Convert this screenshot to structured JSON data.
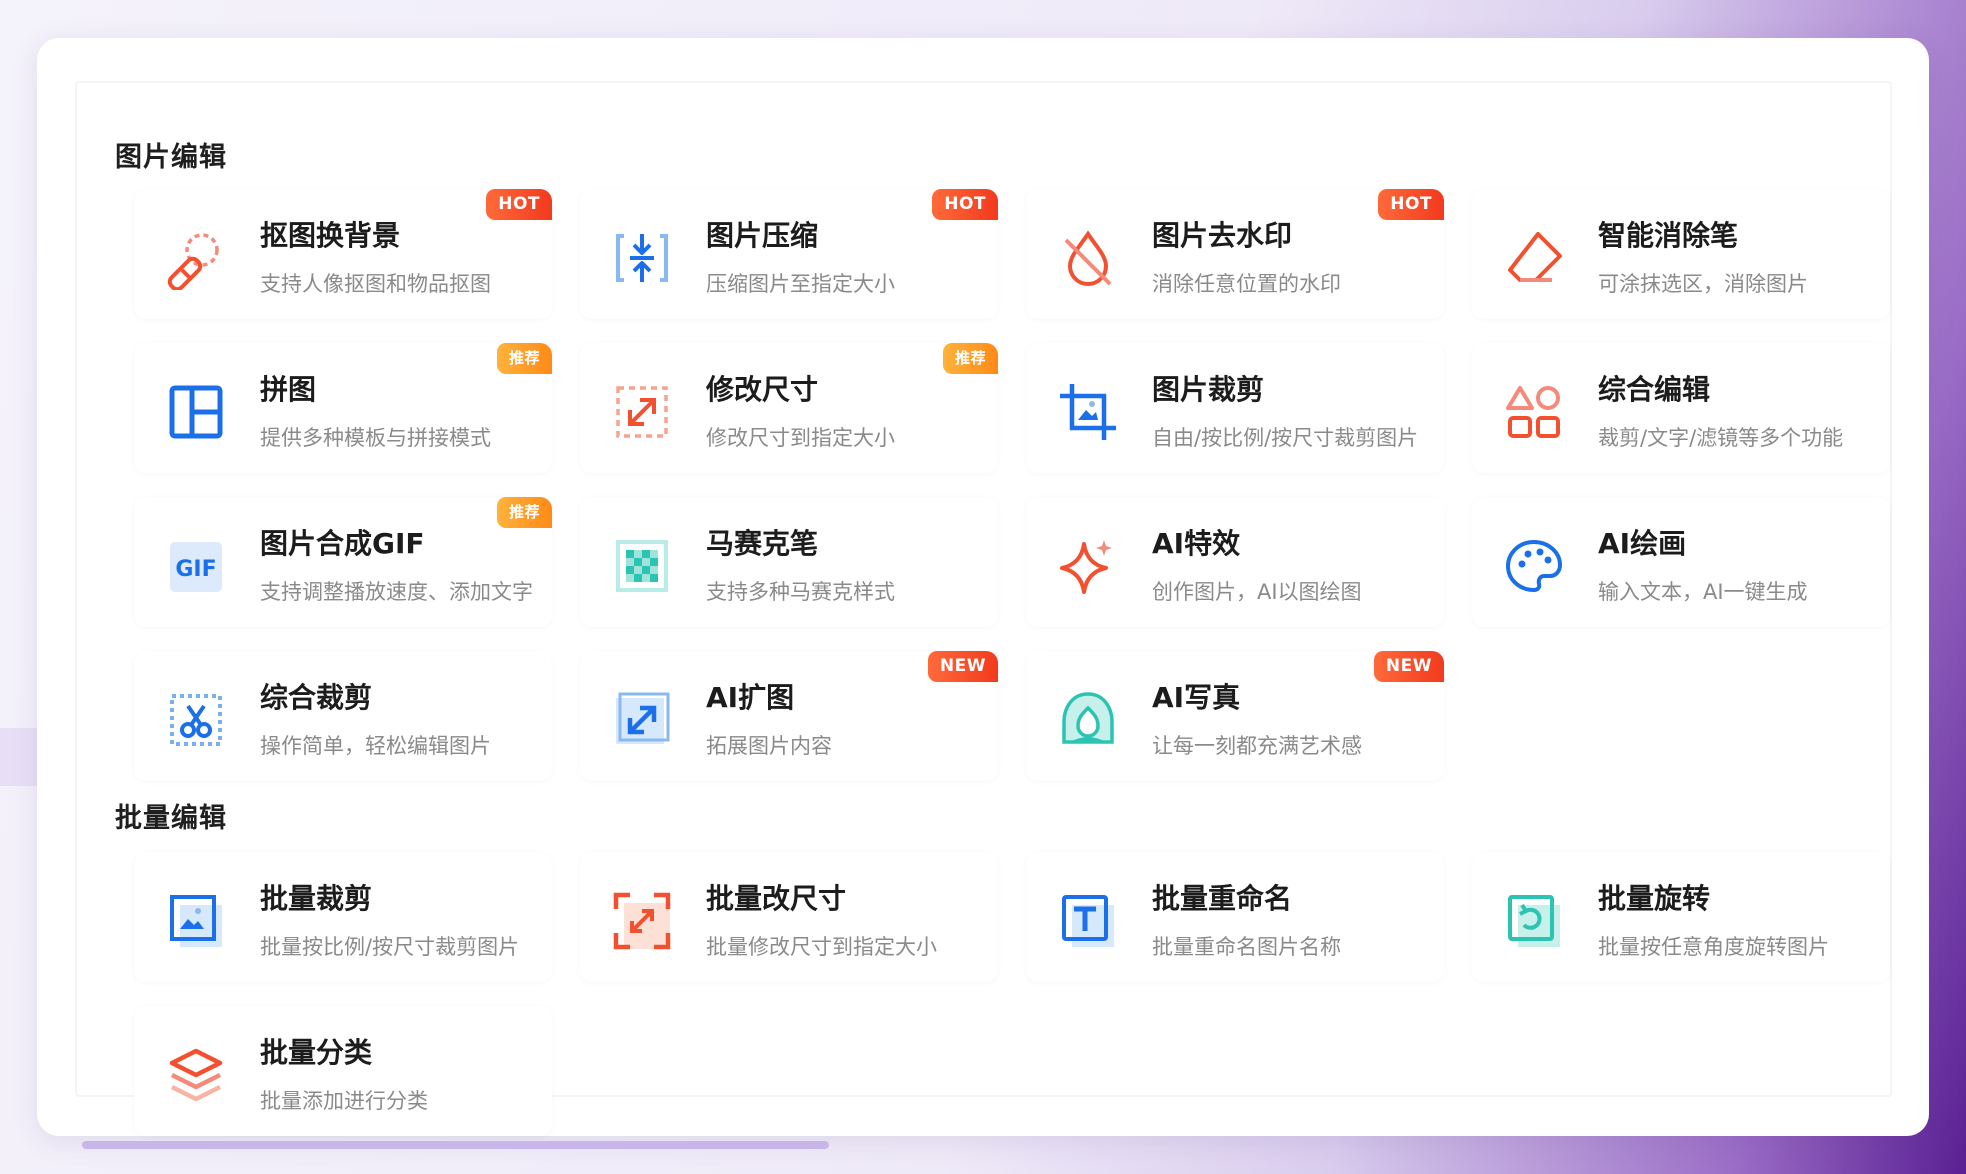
{
  "colors": {
    "hot": "#f4411f",
    "recommend": "#ff9a1f",
    "accent_blue": "#1b6fe8",
    "accent_orange": "#f2502e"
  },
  "sections": [
    {
      "title": "图片编辑",
      "items": [
        {
          "title": "抠图换背景",
          "desc": "支持人像抠图和物品抠图",
          "badge": "HOT",
          "icon": "cutout-icon"
        },
        {
          "title": "图片压缩",
          "desc": "压缩图片至指定大小",
          "badge": "HOT",
          "icon": "compress-icon"
        },
        {
          "title": "图片去水印",
          "desc": "消除任意位置的水印",
          "badge": "HOT",
          "icon": "watermark-remove-icon"
        },
        {
          "title": "智能消除笔",
          "desc": "可涂抹选区，消除图片",
          "badge": "",
          "icon": "eraser-icon"
        },
        {
          "title": "拼图",
          "desc": "提供多种模板与拼接模式",
          "badge": "推荐",
          "icon": "collage-icon"
        },
        {
          "title": "修改尺寸",
          "desc": "修改尺寸到指定大小",
          "badge": "推荐",
          "icon": "resize-icon"
        },
        {
          "title": "图片裁剪",
          "desc": "自由/按比例/按尺寸裁剪图片",
          "badge": "",
          "icon": "crop-icon"
        },
        {
          "title": "综合编辑",
          "desc": "裁剪/文字/滤镜等多个功能",
          "badge": "",
          "icon": "shapes-icon"
        },
        {
          "title": "图片合成GIF",
          "desc": "支持调整播放速度、添加文字",
          "badge": "推荐",
          "icon": "gif-icon"
        },
        {
          "title": "马赛克笔",
          "desc": "支持多种马赛克样式",
          "badge": "",
          "icon": "mosaic-icon"
        },
        {
          "title": "AI特效",
          "desc": "创作图片，AI以图绘图",
          "badge": "",
          "icon": "sparkle-icon"
        },
        {
          "title": "AI绘画",
          "desc": "输入文本，AI一键生成",
          "badge": "",
          "icon": "palette-icon"
        },
        {
          "title": "综合裁剪",
          "desc": "操作简单，轻松编辑图片",
          "badge": "",
          "icon": "scissors-icon"
        },
        {
          "title": "AI扩图",
          "desc": "拓展图片内容",
          "badge": "NEW",
          "icon": "expand-icon"
        },
        {
          "title": "AI写真",
          "desc": "让每一刻都充满艺术感",
          "badge": "NEW",
          "icon": "portrait-icon"
        }
      ]
    },
    {
      "title": "批量编辑",
      "items": [
        {
          "title": "批量裁剪",
          "desc": "批量按比例/按尺寸裁剪图片",
          "badge": "",
          "icon": "batch-crop-icon"
        },
        {
          "title": "批量改尺寸",
          "desc": "批量修改尺寸到指定大小",
          "badge": "",
          "icon": "batch-resize-icon"
        },
        {
          "title": "批量重命名",
          "desc": "批量重命名图片名称",
          "badge": "",
          "icon": "batch-rename-icon"
        },
        {
          "title": "批量旋转",
          "desc": "批量按任意角度旋转图片",
          "badge": "",
          "icon": "batch-rotate-icon"
        },
        {
          "title": "批量分类",
          "desc": "批量添加进行分类",
          "badge": "",
          "icon": "batch-classify-icon"
        }
      ]
    }
  ]
}
